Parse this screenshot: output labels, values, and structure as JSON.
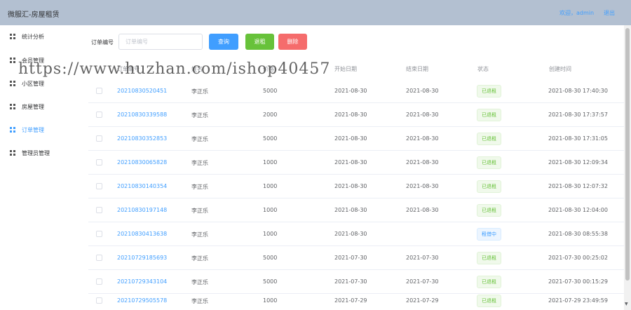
{
  "header": {
    "title": "微服汇-房屋租赁",
    "welcome": "欢迎，admin",
    "logout": "退出"
  },
  "sidebar": {
    "items": [
      {
        "label": "统计分析",
        "icon": "grid-icon",
        "active": false
      },
      {
        "label": "会员管理",
        "icon": "grid-icon",
        "active": false
      },
      {
        "label": "小区管理",
        "icon": "grid-icon",
        "active": false
      },
      {
        "label": "房屋管理",
        "icon": "grid-icon",
        "active": false
      },
      {
        "label": "订单管理",
        "icon": "grid-icon",
        "active": true
      },
      {
        "label": "管理员管理",
        "icon": "grid-icon",
        "active": false
      }
    ]
  },
  "search": {
    "label": "订单编号",
    "placeholder": "订单编号",
    "value": ""
  },
  "toolbar": {
    "query_label": "查询",
    "refund_label": "退租",
    "delete_label": "删除"
  },
  "colors": {
    "accent": "#409eff",
    "success": "#67c23a",
    "danger": "#f56c6c",
    "header_bg": "#b3c0d1"
  },
  "table": {
    "columns": [
      "订单编号",
      "姓名",
      "价格",
      "开始日期",
      "结束日期",
      "状态",
      "创建时间"
    ],
    "rows": [
      {
        "order_no": "20210830520451",
        "name": "李正乐",
        "price": "5000",
        "start": "2021-08-30",
        "end": "2021-08-30",
        "status": "已退租",
        "created": "2021-08-30 17:40:30"
      },
      {
        "order_no": "20210830339588",
        "name": "李正乐",
        "price": "2000",
        "start": "2021-08-30",
        "end": "2021-08-30",
        "status": "已退租",
        "created": "2021-08-30 17:37:57"
      },
      {
        "order_no": "20210830352853",
        "name": "李正乐",
        "price": "5000",
        "start": "2021-08-30",
        "end": "2021-08-30",
        "status": "已退租",
        "created": "2021-08-30 17:31:05"
      },
      {
        "order_no": "20210830065828",
        "name": "李正乐",
        "price": "1000",
        "start": "2021-08-30",
        "end": "2021-08-30",
        "status": "已退租",
        "created": "2021-08-30 12:09:34"
      },
      {
        "order_no": "20210830140354",
        "name": "李正乐",
        "price": "1000",
        "start": "2021-08-30",
        "end": "2021-08-30",
        "status": "已退租",
        "created": "2021-08-30 12:07:32"
      },
      {
        "order_no": "20210830197148",
        "name": "李正乐",
        "price": "1000",
        "start": "2021-08-30",
        "end": "2021-08-30",
        "status": "已退租",
        "created": "2021-08-30 12:04:00"
      },
      {
        "order_no": "20210830413638",
        "name": "李正乐",
        "price": "1000",
        "start": "2021-08-30",
        "end": "",
        "status": "租借中",
        "created": "2021-08-30 08:55:38"
      },
      {
        "order_no": "20210729185693",
        "name": "李正乐",
        "price": "5000",
        "start": "2021-07-30",
        "end": "2021-07-30",
        "status": "已退租",
        "created": "2021-07-30 00:25:02"
      },
      {
        "order_no": "20210729343104",
        "name": "李正乐",
        "price": "5000",
        "start": "2021-07-30",
        "end": "2021-07-30",
        "status": "已退租",
        "created": "2021-07-30 00:15:29"
      },
      {
        "order_no": "20210729505578",
        "name": "李正乐",
        "price": "1000",
        "start": "2021-07-29",
        "end": "2021-07-29",
        "status": "已退租",
        "created": "2021-07-29 23:49:59"
      }
    ]
  },
  "watermark": "https://www.huzhan.com/ishop40457"
}
